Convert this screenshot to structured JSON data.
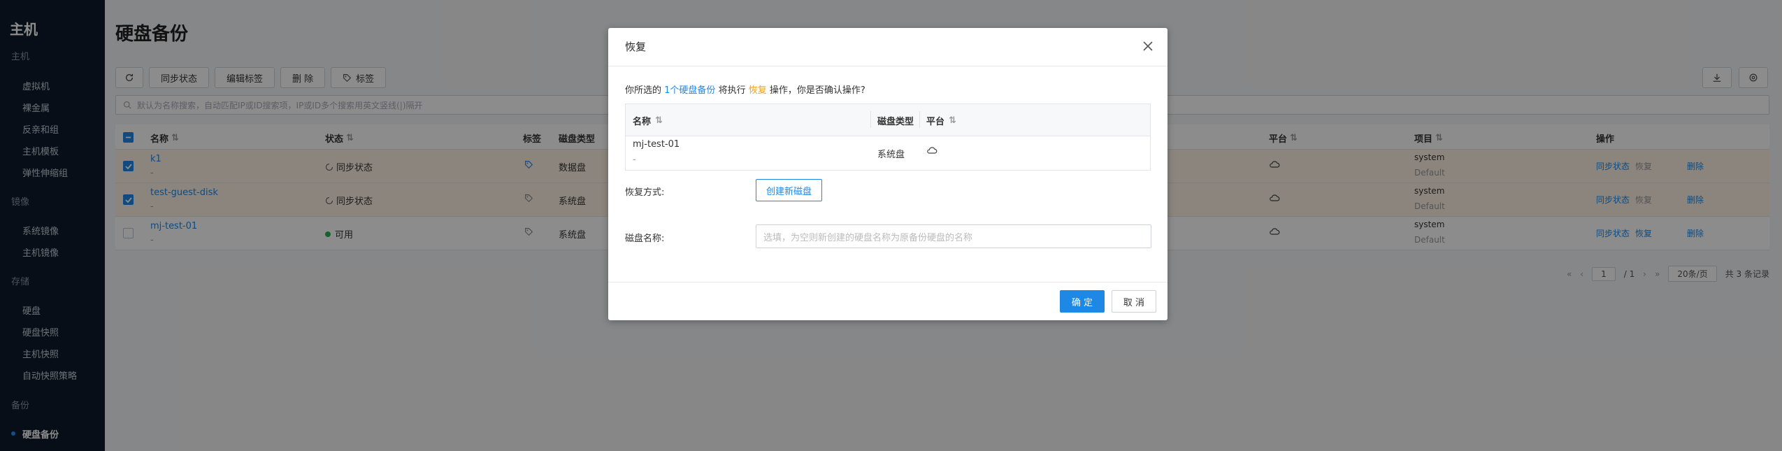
{
  "sidebar": {
    "title": "主机",
    "groups": [
      {
        "label": "主机",
        "items": [
          "虚拟机",
          "裸金属",
          "反亲和组",
          "主机模板",
          "弹性伸缩组"
        ]
      },
      {
        "label": "镜像",
        "items": [
          "系统镜像",
          "主机镜像"
        ]
      },
      {
        "label": "存储",
        "items": [
          "硬盘",
          "硬盘快照",
          "主机快照",
          "自动快照策略"
        ]
      },
      {
        "label": "备份",
        "items": [
          "硬盘备份"
        ]
      }
    ],
    "active": "硬盘备份"
  },
  "page": {
    "title": "硬盘备份",
    "toolbar": [
      "同步状态",
      "编辑标签",
      "删 除",
      "标签"
    ],
    "search_placeholder": "默认为名称搜索，自动匹配IP或ID搜索项，IP或ID多个搜索用英文竖线(|)隔开"
  },
  "table": {
    "headers": [
      "名称",
      "状态",
      "标签",
      "磁盘类型",
      "平台",
      "项目",
      "操作"
    ],
    "rows": [
      {
        "name": "k1",
        "sub": "-",
        "status": "同步状态",
        "disk_type": "数据盘",
        "project": "system",
        "domain": "Default",
        "selected": true,
        "actions": [
          "同步状态",
          "恢复",
          "删除"
        ]
      },
      {
        "name": "test-guest-disk",
        "sub": "-",
        "status": "同步状态",
        "disk_type": "系统盘",
        "project": "system",
        "domain": "Default",
        "selected": true,
        "actions": [
          "同步状态",
          "恢复",
          "删除"
        ]
      },
      {
        "name": "mj-test-01",
        "sub": "-",
        "status": "可用",
        "disk_type": "系统盘",
        "project": "system",
        "domain": "Default",
        "selected": false,
        "actions": [
          "同步状态",
          "恢复",
          "删除"
        ]
      }
    ],
    "pager": {
      "page": "1",
      "total_pages": "/ 1",
      "page_size": "20条/页",
      "total": "共 3 条记录"
    }
  },
  "modal": {
    "title": "恢复",
    "confirm_prefix": "你所选的",
    "confirm_count": "1个硬盘备份",
    "confirm_mid": "将执行",
    "confirm_action": "恢复",
    "confirm_suffix": "操作，你是否确认操作?",
    "table_headers": [
      "名称",
      "磁盘类型",
      "平台"
    ],
    "row": {
      "name": "mj-test-01",
      "sub": "-",
      "disk_type": "系统盘"
    },
    "restore_label": "恢复方式:",
    "restore_button": "创建新磁盘",
    "disk_name_label": "磁盘名称:",
    "disk_name_placeholder": "选填，为空则新创建的硬盘名称为原备份硬盘的名称",
    "ok": "确 定",
    "cancel": "取 消"
  },
  "colors": {
    "accent": "#1e88e5",
    "warning": "#f39c12",
    "sidebar": "#0e1a2b",
    "available": "#2bb24c"
  }
}
